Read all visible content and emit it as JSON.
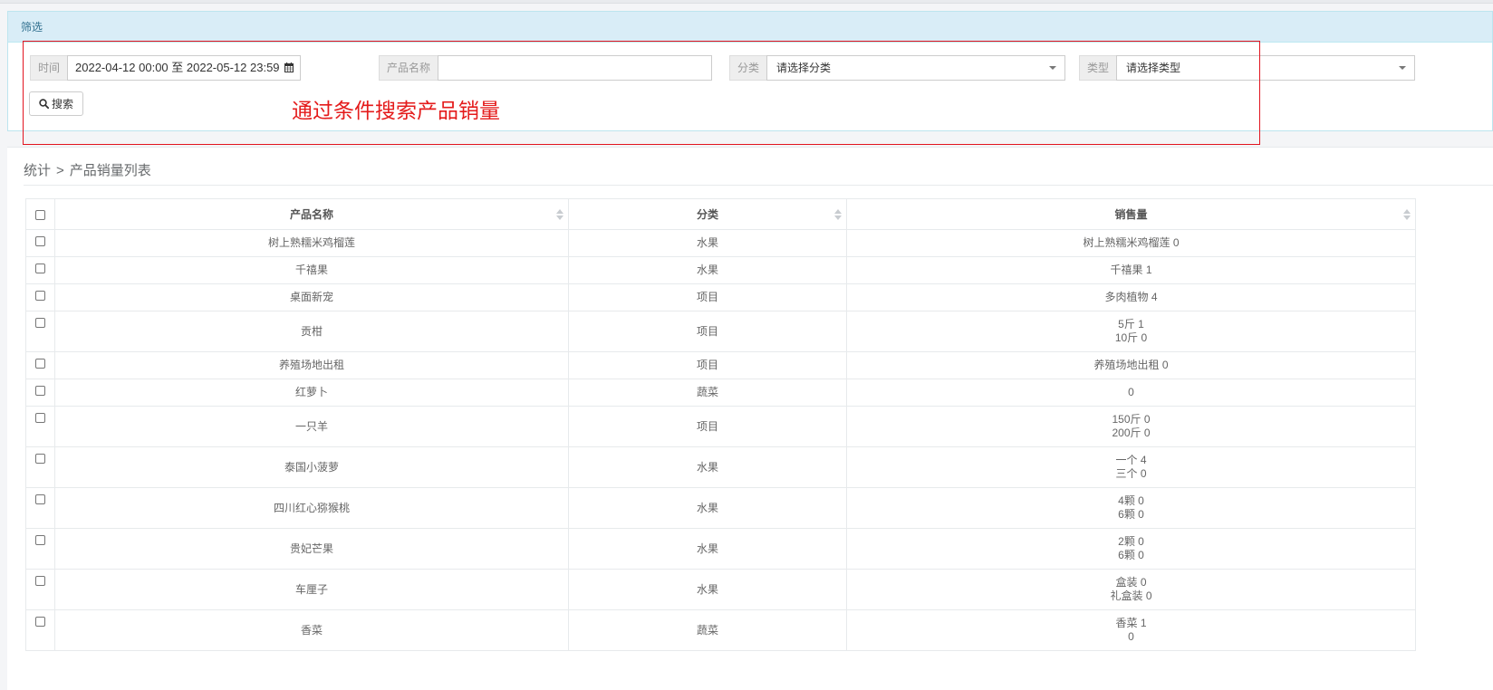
{
  "filter": {
    "title": "筛选",
    "time_label": "时间",
    "time_value": "2022-04-12 00:00 至 2022-05-12 23:59",
    "name_label": "产品名称",
    "name_value": "",
    "category_label": "分类",
    "category_value": "请选择分类",
    "type_label": "类型",
    "type_value": "请选择类型",
    "search_label": "搜索"
  },
  "annotation": {
    "text": "通过条件搜索产品销量",
    "color": "#e41b1b"
  },
  "breadcrumb": {
    "parent": "统计",
    "separator": ">",
    "current": "产品销量列表"
  },
  "table": {
    "columns": [
      "产品名称",
      "分类",
      "销售量"
    ],
    "rows": [
      {
        "name": "树上熟糯米鸡榴莲",
        "category": "水果",
        "sales": [
          "树上熟糯米鸡榴莲 0"
        ]
      },
      {
        "name": "千禧果",
        "category": "水果",
        "sales": [
          "千禧果 1"
        ]
      },
      {
        "name": "桌面新宠",
        "category": "项目",
        "sales": [
          "多肉植物 4"
        ]
      },
      {
        "name": "贡柑",
        "category": "项目",
        "sales": [
          "5斤 1",
          "10斤 0"
        ]
      },
      {
        "name": "养殖场地出租",
        "category": "项目",
        "sales": [
          "养殖场地出租 0"
        ]
      },
      {
        "name": "红萝卜",
        "category": "蔬菜",
        "sales": [
          "0"
        ]
      },
      {
        "name": "一只羊",
        "category": "项目",
        "sales": [
          "150斤 0",
          "200斤 0"
        ]
      },
      {
        "name": "泰国小菠萝",
        "category": "水果",
        "sales": [
          "一个 4",
          "三个 0"
        ]
      },
      {
        "name": "四川红心猕猴桃",
        "category": "水果",
        "sales": [
          "4颗 0",
          "6颗 0"
        ]
      },
      {
        "name": "贵妃芒果",
        "category": "水果",
        "sales": [
          "2颗 0",
          "6颗 0"
        ]
      },
      {
        "name": "车厘子",
        "category": "水果",
        "sales": [
          "盒装 0",
          "礼盒装 0"
        ]
      },
      {
        "name": "香菜",
        "category": "蔬菜",
        "sales": [
          "香菜 1",
          "0"
        ]
      }
    ]
  }
}
